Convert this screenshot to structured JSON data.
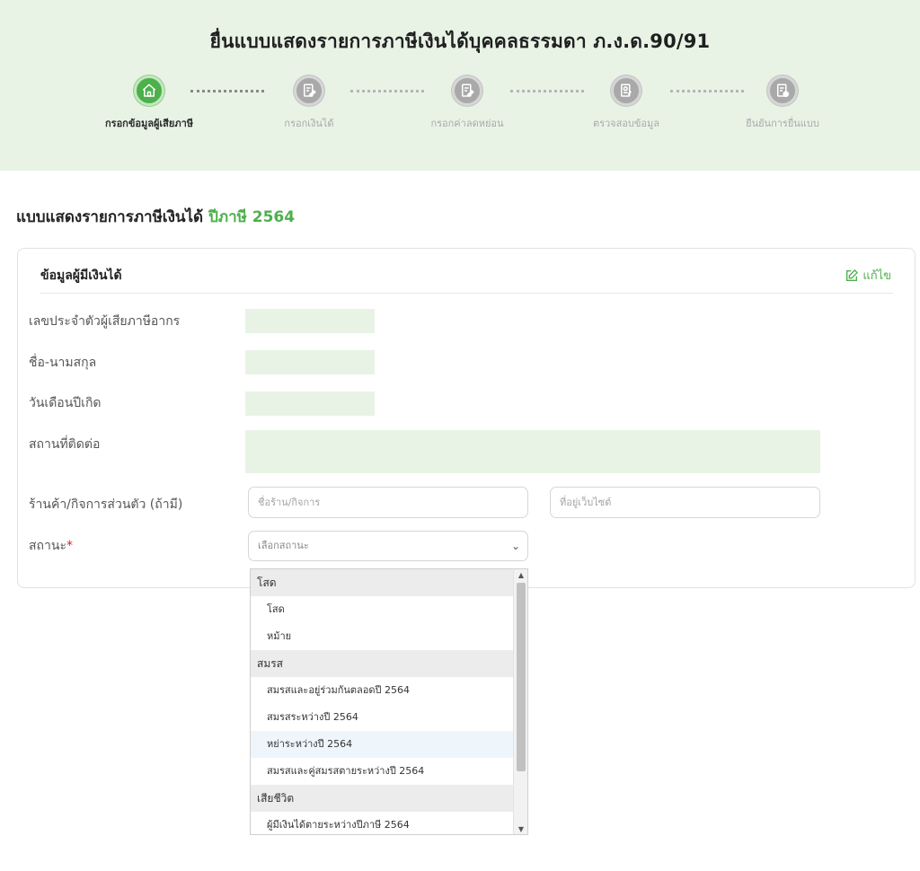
{
  "header": {
    "title": "ยื่นแบบแสดงรายการภาษีเงินได้บุคคลธรรมดา ภ.ง.ด.90/91",
    "steps": [
      {
        "label": "กรอกข้อมูลผู้เสียภาษี",
        "active": true,
        "icon": "home-icon"
      },
      {
        "label": "กรอกเงินได้",
        "active": false,
        "icon": "document-edit-icon"
      },
      {
        "label": "กรอกค่าลดหย่อน",
        "active": false,
        "icon": "document-edit-icon"
      },
      {
        "label": "ตรวจสอบข้อมูล",
        "active": false,
        "icon": "document-check-icon"
      },
      {
        "label": "ยืนยันการยื่นแบบ",
        "active": false,
        "icon": "document-confirm-icon"
      }
    ]
  },
  "page": {
    "heading": "แบบแสดงรายการภาษีเงินได้",
    "year": "ปีภาษี 2564"
  },
  "card": {
    "title": "ข้อมูลผู้มีเงินได้",
    "edit_label": "แก้ไข",
    "fields": {
      "tax_id_label": "เลขประจำตัวผู้เสียภาษีอากร",
      "name_label": "ชื่อ-นามสกุล",
      "birthdate_label": "วันเดือนปีเกิด",
      "address_label": "สถานที่ติดต่อ",
      "shop_label": "ร้านค้า/กิจการส่วนตัว (ถ้ามี)",
      "shop_name_placeholder": "ชื่อร้าน/กิจการ",
      "website_placeholder": "ที่อยู่เว็บไซต์",
      "status_label": "สถานะ",
      "status_required_mark": "*",
      "status_placeholder": "เลือกสถานะ"
    }
  },
  "status_dropdown": {
    "groups": [
      {
        "label": "โสด",
        "options": [
          "โสด",
          "หม้าย"
        ]
      },
      {
        "label": "สมรส",
        "options": [
          "สมรสและอยู่ร่วมกันตลอดปี 2564",
          "สมรสระหว่างปี 2564",
          "หย่าระหว่างปี 2564",
          "สมรสและคู่สมรสตายระหว่างปี 2564"
        ]
      },
      {
        "label": "เสียชีวิต",
        "options": [
          "ผู้มีเงินได้ตายระหว่างปีภาษี 2564"
        ]
      }
    ],
    "hovered_option": "หย่าระหว่างปี 2564"
  },
  "colors": {
    "accent": "#4cb04c",
    "header_bg": "#e8f3e6",
    "required": "#e02020"
  }
}
